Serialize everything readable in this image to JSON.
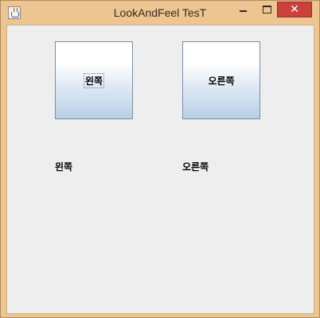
{
  "window": {
    "title": "LookAndFeel TesT",
    "controls": {
      "minimize_icon": "minimize-icon",
      "maximize_icon": "maximize-icon",
      "close_glyph": "✕"
    },
    "colors": {
      "frame": "#ecc590",
      "close_button": "#c9413a",
      "content_background": "#eeeeee",
      "button_gradient_bottom": "#b8cfe6"
    }
  },
  "buttons": {
    "left_label": "왼쪽",
    "right_label": "오른쪽"
  },
  "labels": {
    "left_text": "왼쪽",
    "right_text": "오른쪽"
  }
}
